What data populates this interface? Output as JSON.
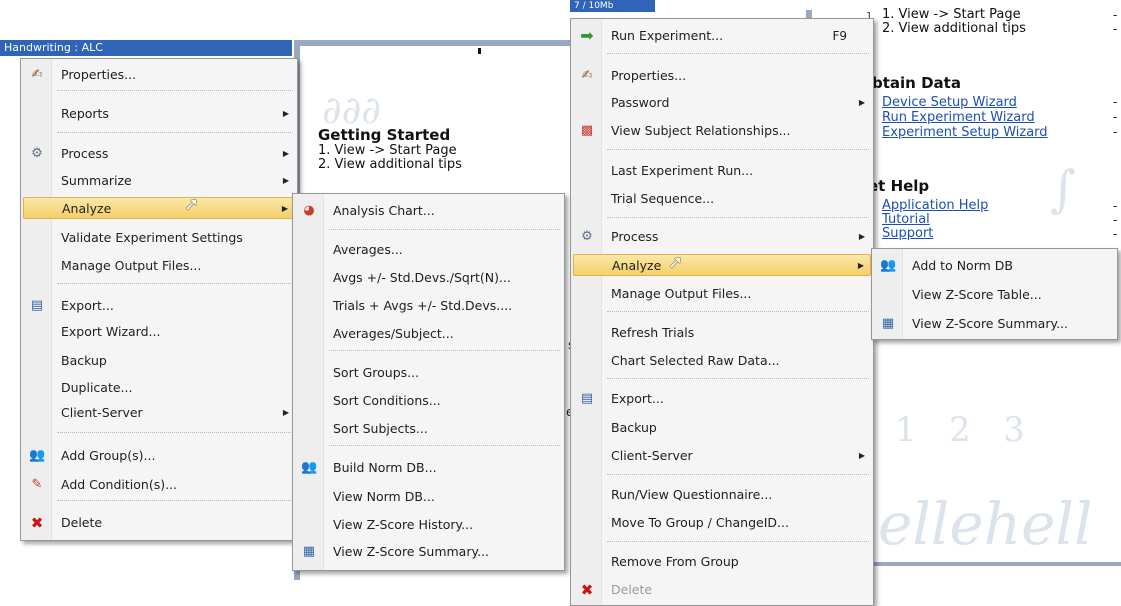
{
  "background": {
    "window_title": "Handwriting : ALC",
    "top_tab_label": "7 / 10Mb",
    "getting_started": {
      "title": "Getting Started",
      "items": [
        "1.  View -> Start Page",
        "2.  View additional tips"
      ]
    },
    "right_panel": {
      "top_items": [
        "1.  View -> Start Page",
        "2.  View additional tips"
      ],
      "obtain_title": "btain Data",
      "obtain_links": [
        "Device Setup Wizard",
        "Run Experiment Wizard",
        "Experiment Setup Wizard"
      ],
      "help_title": "et Help",
      "help_links": [
        "Application Help",
        "Tutorial",
        "Support"
      ],
      "dashes": [
        "-",
        "-",
        "-",
        "-",
        "-",
        "-",
        "-",
        "-",
        "-"
      ]
    },
    "stray_chars": [
      "s",
      "e"
    ]
  },
  "menu_left": {
    "items": [
      {
        "label": "Properties...",
        "icon": "properties-icon"
      },
      {
        "label": "Reports"
      },
      {
        "label": "Process",
        "icon": "process-icon"
      },
      {
        "label": "Summarize"
      },
      {
        "label": "Analyze"
      },
      {
        "label": "Validate Experiment Settings"
      },
      {
        "label": "Manage Output Files..."
      },
      {
        "label": "Export...",
        "icon": "export-icon"
      },
      {
        "label": "Export Wizard..."
      },
      {
        "label": "Backup"
      },
      {
        "label": "Duplicate..."
      },
      {
        "label": "Client-Server"
      },
      {
        "label": "Add Group(s)...",
        "icon": "add-group-icon"
      },
      {
        "label": "Add Condition(s)...",
        "icon": "add-condition-icon"
      },
      {
        "label": "Delete",
        "icon": "delete-icon"
      }
    ]
  },
  "menu_analyze_left": {
    "items": [
      {
        "label": "Analysis Chart...",
        "icon": "analysis-chart-icon"
      },
      {
        "label": "Averages..."
      },
      {
        "label": "Avgs +/- Std.Devs./Sqrt(N)..."
      },
      {
        "label": "Trials + Avgs +/- Std.Devs...."
      },
      {
        "label": "Averages/Subject..."
      },
      {
        "label": "Sort Groups..."
      },
      {
        "label": "Sort Conditions..."
      },
      {
        "label": "Sort Subjects..."
      },
      {
        "label": "Build Norm DB...",
        "icon": "norm-db-icon"
      },
      {
        "label": "View Norm DB..."
      },
      {
        "label": "View Z-Score History..."
      },
      {
        "label": "View Z-Score Summary...",
        "icon": "zscore-summary-icon"
      }
    ]
  },
  "menu_right": {
    "items": [
      {
        "label": "Run Experiment...",
        "shortcut": "F9",
        "icon": "run-arrow-icon"
      },
      {
        "label": "Properties...",
        "icon": "properties-icon"
      },
      {
        "label": "Password"
      },
      {
        "label": "View Subject Relationships...",
        "icon": "relationships-icon"
      },
      {
        "label": "Last Experiment Run..."
      },
      {
        "label": "Trial Sequence..."
      },
      {
        "label": "Process",
        "icon": "process-icon"
      },
      {
        "label": "Analyze"
      },
      {
        "label": "Manage Output Files..."
      },
      {
        "label": "Refresh Trials"
      },
      {
        "label": "Chart Selected Raw Data..."
      },
      {
        "label": "Export...",
        "icon": "export-icon"
      },
      {
        "label": "Backup"
      },
      {
        "label": "Client-Server"
      },
      {
        "label": "Run/View Questionnaire..."
      },
      {
        "label": "Move To Group / ChangeID..."
      },
      {
        "label": "Remove From Group"
      },
      {
        "label": "Delete",
        "icon": "delete-icon"
      }
    ]
  },
  "menu_analyze_right": {
    "items": [
      {
        "label": "Add to Norm DB",
        "icon": "norm-db-icon"
      },
      {
        "label": "View Z-Score Table..."
      },
      {
        "label": "View Z-Score Summary...",
        "icon": "zscore-summary-icon"
      }
    ]
  },
  "colors": {
    "highlight": "#f5cf6a",
    "link": "#1b4fb5",
    "titlebar": "#2f64b6"
  }
}
